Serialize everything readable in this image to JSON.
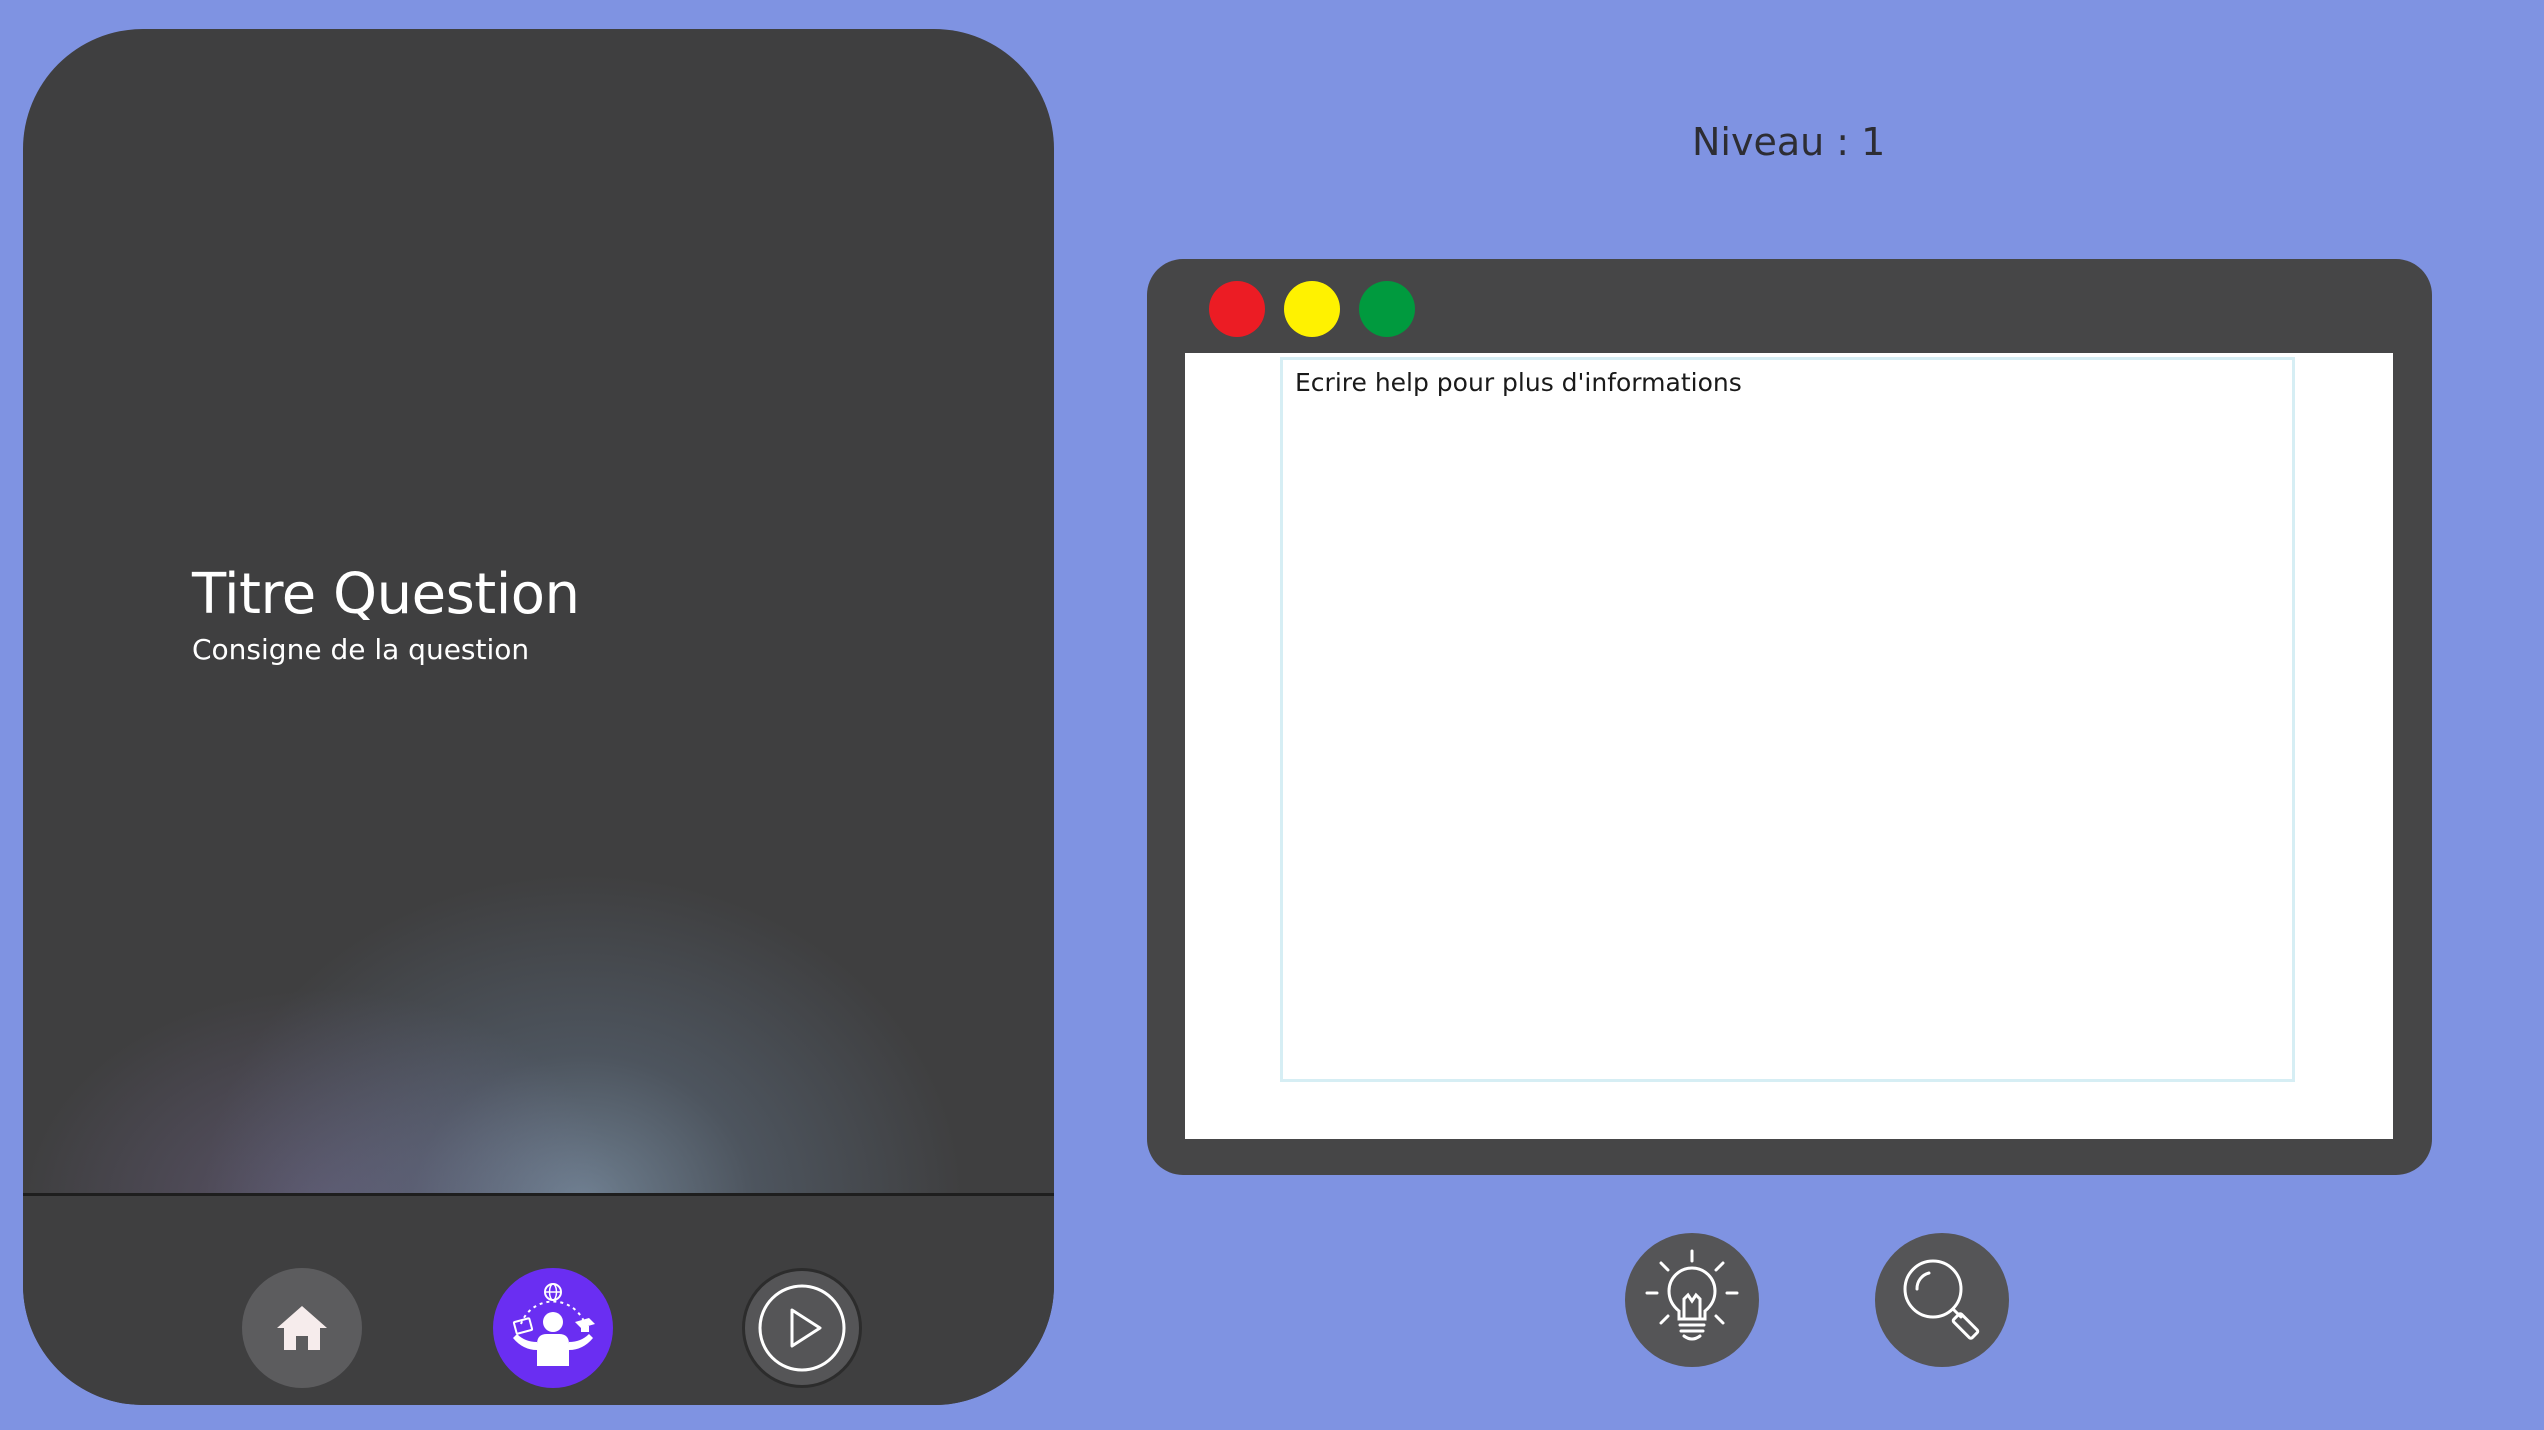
{
  "question": {
    "title": "Titre Question",
    "instruction": "Consigne de la question"
  },
  "level": {
    "label": "Niveau : 1"
  },
  "terminal": {
    "placeholder": "Ecrire help pour plus d'informations",
    "window_controls": {
      "close_color": "#ec1c24",
      "minimize_color": "#fff200",
      "maximize_color": "#009a3e"
    }
  },
  "nav": {
    "items": [
      {
        "icon": "home-icon"
      },
      {
        "icon": "learner-icon",
        "accent": "#6a2ef2"
      },
      {
        "icon": "play-icon"
      }
    ]
  },
  "tools": [
    {
      "icon": "lightbulb-icon"
    },
    {
      "icon": "magnifier-icon"
    }
  ],
  "colors": {
    "background": "#7f93e2",
    "panel": "#3f3f40",
    "terminal_frame": "#464647"
  }
}
